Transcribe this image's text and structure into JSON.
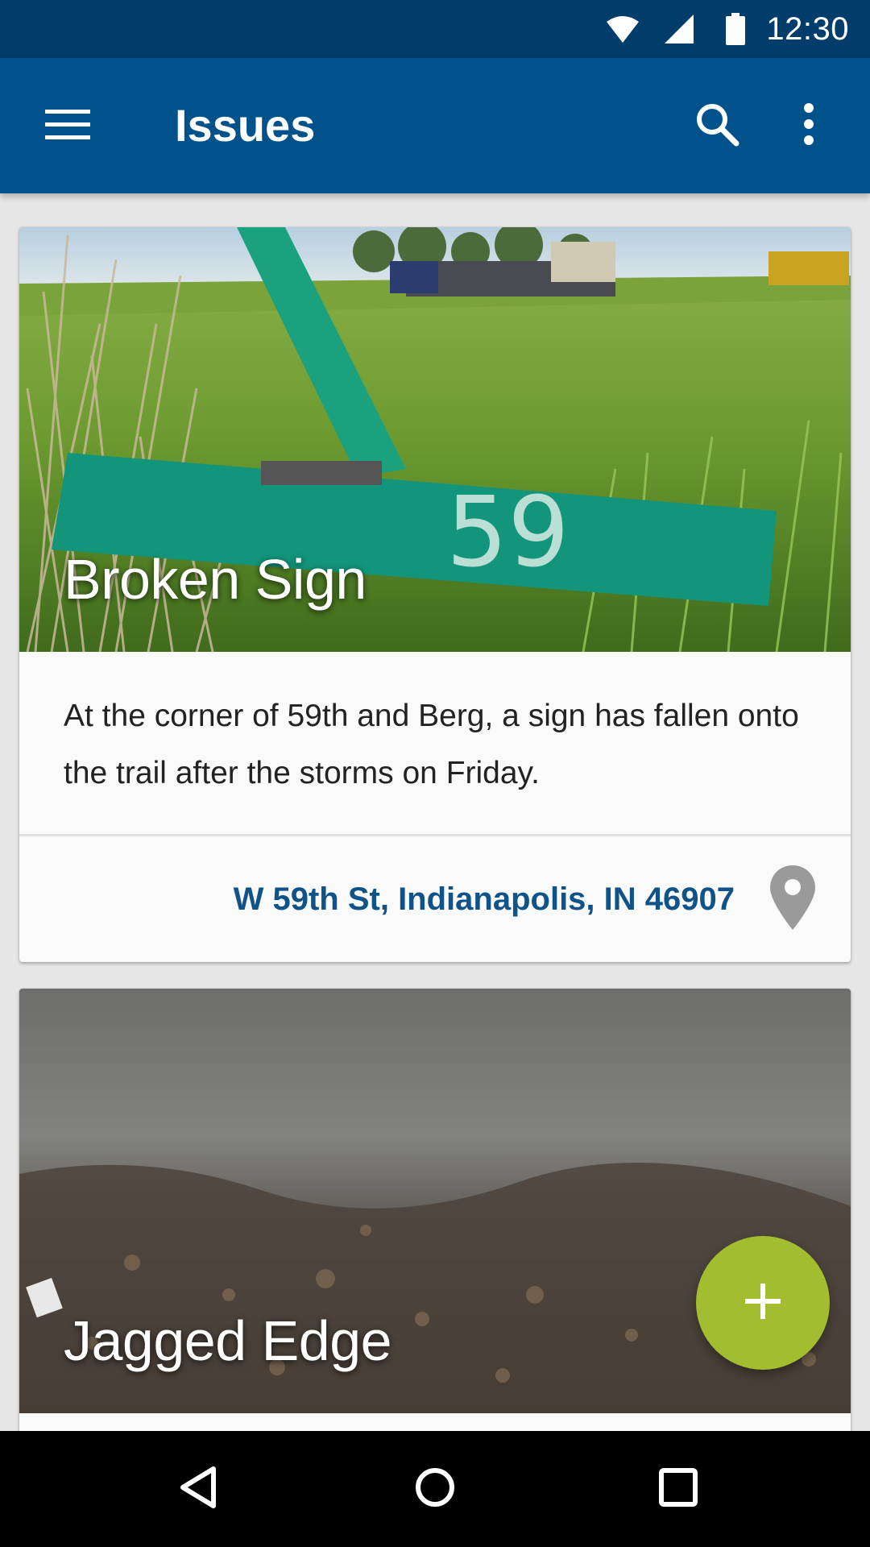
{
  "status_bar": {
    "time": "12:30",
    "icons": [
      "wifi-icon",
      "cell-signal-icon",
      "battery-icon"
    ]
  },
  "app_bar": {
    "title": "Issues",
    "icons": [
      "menu-icon",
      "search-icon",
      "more-vert-icon"
    ],
    "background_color": "#01528b"
  },
  "issues": [
    {
      "title": "Broken Sign",
      "description": "At the corner of 59th and Berg, a sign has fallen onto the trail after the storms on Friday.",
      "address": "W 59th St, Indianapolis, IN 46907",
      "location_icon": "location-pin-icon",
      "image": "photo of a fallen green street sign in grass"
    },
    {
      "title": "Jagged Edge",
      "image": "photo of a broken asphalt path edge"
    }
  ],
  "fab": {
    "icon": "add-icon",
    "color": "#a2bd2f"
  },
  "nav_bar": {
    "icons": [
      "back-icon",
      "home-icon",
      "recents-icon"
    ]
  },
  "colors": {
    "status_bar": "#003d6b",
    "accent_text": "#0f5389"
  }
}
